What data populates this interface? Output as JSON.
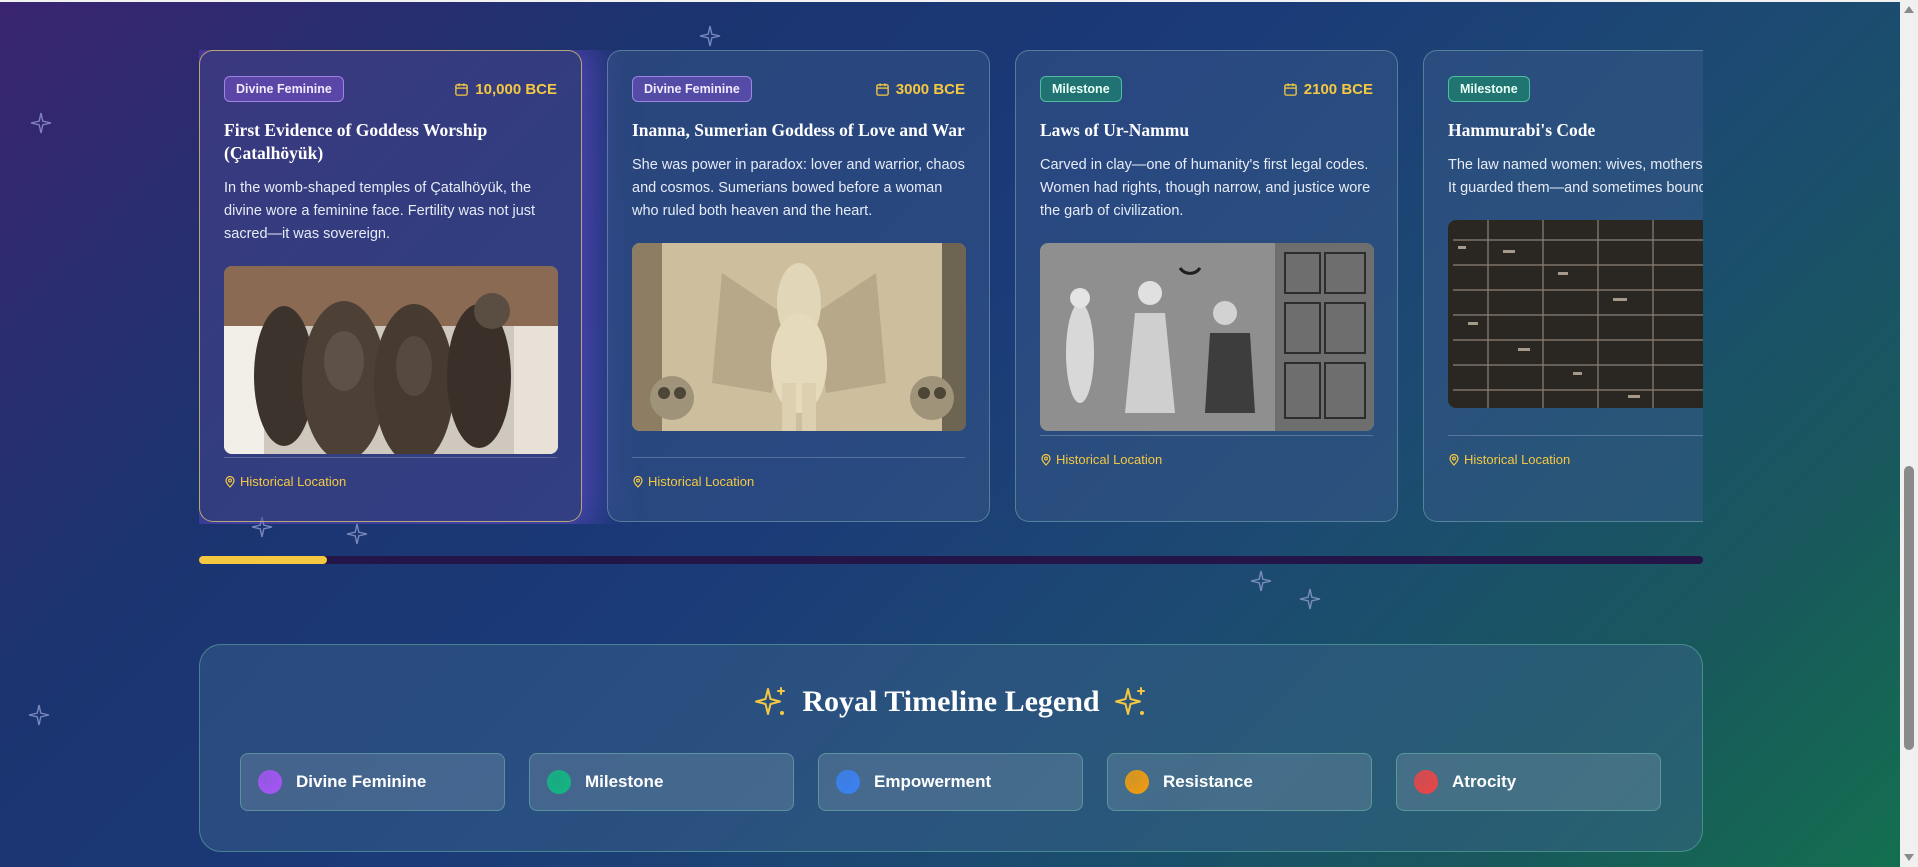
{
  "timeline": {
    "cards": [
      {
        "badge": "Divine Feminine",
        "badge_type": "divine",
        "date": "10,000 BCE",
        "title": "First Evidence of Goddess Worship (Çatalhöyük)",
        "description": "In the womb-shaped temples of Çatalhöyük, the divine wore a feminine face. Fertility was not just sacred—it was sovereign.",
        "image_icon": "clay-figurine-image",
        "location": "Historical Location"
      },
      {
        "badge": "Divine Feminine",
        "badge_type": "divine",
        "date": "3000 BCE",
        "title": "Inanna, Sumerian Goddess of Love and War",
        "description": "She was power in paradox: lover and warrior, chaos and cosmos. Sumerians bowed before a woman who ruled both heaven and the heart.",
        "image_icon": "relief-goddess-image",
        "location": "Historical Location"
      },
      {
        "badge": "Milestone",
        "badge_type": "milestone",
        "date": "2100 BCE",
        "title": "Laws of Ur-Nammu",
        "description": "Carved in clay—one of humanity's first legal codes. Women had rights, though narrow, and justice wore the garb of civilization.",
        "image_icon": "cylinder-seal-image",
        "location": "Historical Location"
      },
      {
        "badge": "Milestone",
        "badge_type": "milestone",
        "date": "",
        "title": "Hammurabi's Code",
        "description": "The law named women: wives, mothers, daughters. It guarded them—and sometimes bound them.",
        "image_icon": "cuneiform-stele-image",
        "location": "Historical Location"
      }
    ],
    "progress_fraction": 0.085
  },
  "legend": {
    "title": "Royal Timeline Legend",
    "items": [
      {
        "label": "Divine Feminine",
        "color": "#a855f7"
      },
      {
        "label": "Milestone",
        "color": "#10b981"
      },
      {
        "label": "Empowerment",
        "color": "#3b82f6"
      },
      {
        "label": "Resistance",
        "color": "#f59e0b"
      },
      {
        "label": "Atrocity",
        "color": "#ef4444"
      }
    ]
  },
  "colors": {
    "accent_gold": "#f5c842",
    "sparkle": "#f5c842"
  }
}
